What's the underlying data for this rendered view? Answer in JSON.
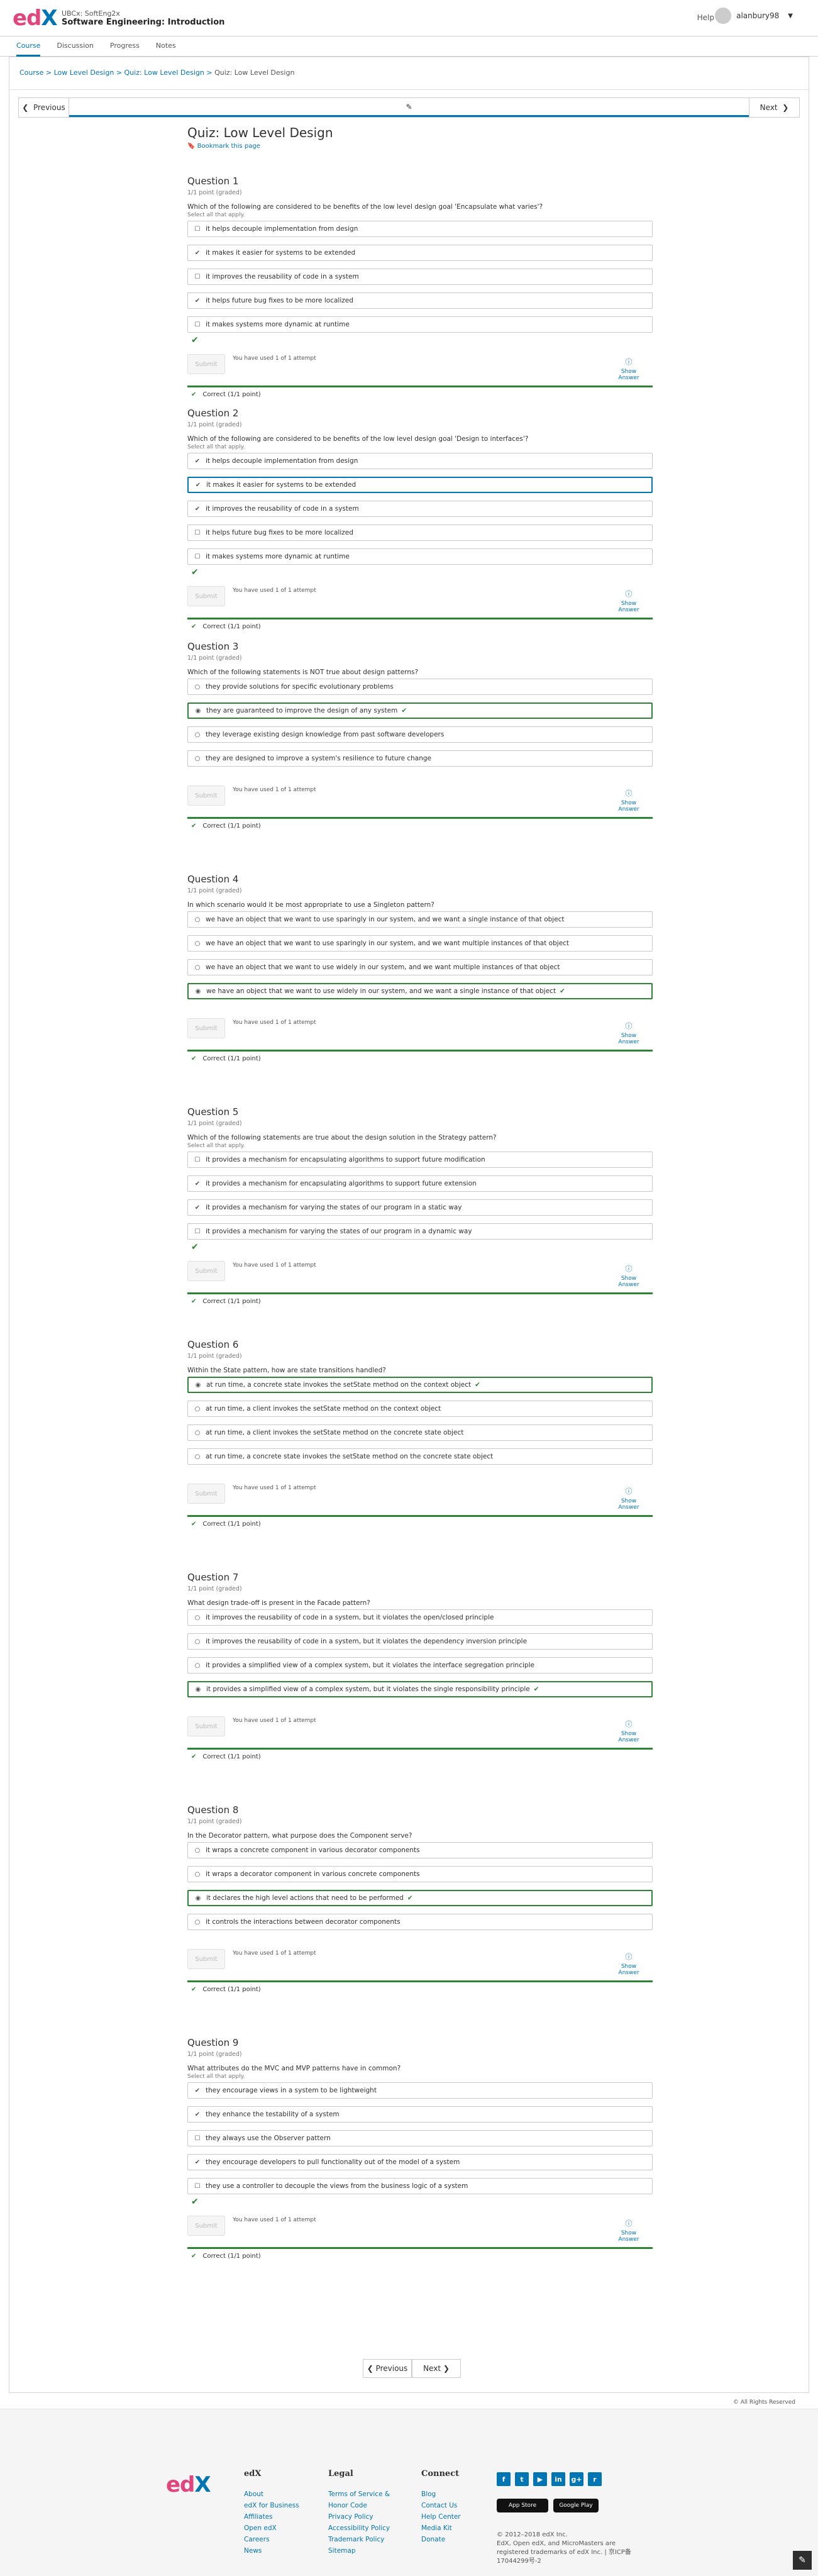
{
  "header": {
    "org": "UBCx: SoftEng2x",
    "course": "Software Engineering: Introduction",
    "help": "Help",
    "username": "alanbury98"
  },
  "tabs": [
    "Course",
    "Discussion",
    "Progress",
    "Notes"
  ],
  "breadcrumbs": {
    "course": "Course",
    "section": "Low Level Design",
    "subsection": "Quiz: Low Level Design",
    "current": "Quiz: Low Level Design"
  },
  "seqnav": {
    "prev": "Previous",
    "next": "Next"
  },
  "unit": {
    "title": "Quiz: Low Level Design",
    "bookmark": "Bookmark this page"
  },
  "common": {
    "points": "1/1 point (graded)",
    "select_all": "Select all that apply.",
    "submit": "Submit",
    "attempts": "You have used 1 of 1 attempt",
    "show_answer": "Show Answer",
    "correct": "Correct (1/1 point)"
  },
  "questions": [
    {
      "title": "Question 1",
      "text": "Which of the following are considered to be benefits of the low level design goal 'Encapsulate what varies'?",
      "multi": true,
      "options": [
        {
          "t": "it helps decouple implementation from design",
          "m": "unchecked"
        },
        {
          "t": "it makes it easier for systems to be extended",
          "m": "checked"
        },
        {
          "t": "it improves the reusability of code in a system",
          "m": "unchecked"
        },
        {
          "t": "it helps future bug fixes to be more localized",
          "m": "checked"
        },
        {
          "t": "it makes systems more dynamic at runtime",
          "m": "unchecked"
        }
      ]
    },
    {
      "title": "Question 2",
      "text": "Which of the following are considered to be benefits of the low level design goal 'Design to interfaces'?",
      "multi": true,
      "options": [
        {
          "t": "it helps decouple implementation from design",
          "m": "checked"
        },
        {
          "t": "it makes it easier for systems to be extended",
          "m": "checked",
          "sel": true
        },
        {
          "t": "it improves the reusability of code in a system",
          "m": "checked"
        },
        {
          "t": "it helps future bug fixes to be more localized",
          "m": "unchecked"
        },
        {
          "t": "it makes systems more dynamic at runtime",
          "m": "unchecked"
        }
      ]
    },
    {
      "title": "Question 3",
      "text": "Which of the following statements is NOT true about design patterns?",
      "multi": false,
      "options": [
        {
          "t": "they provide solutions for specific evolutionary problems",
          "m": "unchecked"
        },
        {
          "t": "they are guaranteed to improve the design of any system",
          "m": "checked",
          "hl": true
        },
        {
          "t": "they leverage existing design knowledge from past software developers",
          "m": "unchecked"
        },
        {
          "t": "they are designed to improve a system's resilience to future change",
          "m": "unchecked"
        }
      ]
    },
    {
      "title": "Question 4",
      "text": "In which scenario would it be most appropriate to use a Singleton pattern?",
      "multi": false,
      "options": [
        {
          "t": "we have an object that we want to use sparingly in our system, and we want a single instance of that object",
          "m": "unchecked"
        },
        {
          "t": "we have an object that we want to use sparingly in our system, and we want multiple instances of that object",
          "m": "unchecked"
        },
        {
          "t": "we have an object that we want to use widely in our system, and we want multiple instances of that object",
          "m": "unchecked"
        },
        {
          "t": "we have an object that we want to use widely in our system, and we want a single instance of that object",
          "m": "checked",
          "hl": true
        }
      ]
    },
    {
      "title": "Question 5",
      "text": "Which of the following statements are true about the design solution in the Strategy pattern?",
      "multi": true,
      "options": [
        {
          "t": "it provides a mechanism for encapsulating algorithms to support future modification",
          "m": "unchecked"
        },
        {
          "t": "it provides a mechanism for encapsulating algorithms to support future extension",
          "m": "checked"
        },
        {
          "t": "it provides a mechanism for varying the states of our program in a static way",
          "m": "checked"
        },
        {
          "t": "it provides a mechanism for varying the states of our program in a dynamic way",
          "m": "unchecked"
        }
      ]
    },
    {
      "title": "Question 6",
      "text": "Within the State pattern, how are state transitions handled?",
      "multi": false,
      "options": [
        {
          "t": "at run time, a concrete state invokes the setState method on the context object",
          "m": "checked",
          "hl": true
        },
        {
          "t": "at run time, a client invokes the setState method on the context object",
          "m": "unchecked"
        },
        {
          "t": "at run time, a client invokes the setState method on the concrete state object",
          "m": "unchecked"
        },
        {
          "t": "at run time, a concrete state invokes the setState method on the concrete state object",
          "m": "unchecked"
        }
      ]
    },
    {
      "title": "Question 7",
      "text": "What design trade-off is present in the Facade pattern?",
      "multi": false,
      "options": [
        {
          "t": "it improves the reusability of code in a system, but it violates the open/closed principle",
          "m": "unchecked"
        },
        {
          "t": "it improves the reusability of code in a system, but it violates the dependency inversion principle",
          "m": "unchecked"
        },
        {
          "t": "it provides a simplified view of a complex system, but it violates the interface segregation principle",
          "m": "unchecked"
        },
        {
          "t": "it provides a simplified view of a complex system, but it violates the single responsibility principle",
          "m": "checked",
          "hl": true
        }
      ]
    },
    {
      "title": "Question 8",
      "text": "In the Decorator pattern, what purpose does the Component serve?",
      "multi": false,
      "options": [
        {
          "t": "it wraps a concrete component in various decorator components",
          "m": "unchecked"
        },
        {
          "t": "it wraps a decorator component in various concrete components",
          "m": "unchecked"
        },
        {
          "t": "it declares the high level actions that need to be performed",
          "m": "checked",
          "hl": true
        },
        {
          "t": "it controls the interactions between decorator components",
          "m": "unchecked"
        }
      ]
    },
    {
      "title": "Question 9",
      "text": "What attributes do the MVC and MVP patterns have in common?",
      "multi": true,
      "options": [
        {
          "t": "they encourage views in a system to be lightweight",
          "m": "checked"
        },
        {
          "t": "they enhance the testability of a system",
          "m": "checked"
        },
        {
          "t": "they always use the Observer pattern",
          "m": "unchecked"
        },
        {
          "t": "they encourage developers to pull functionality out of the model of a system",
          "m": "checked"
        },
        {
          "t": "they use a controller to decouple the views from the business logic of a system",
          "m": "unchecked"
        }
      ]
    }
  ],
  "bottomnav": {
    "prev": "Previous",
    "next": "Next"
  },
  "rights": "© All Rights Reserved",
  "footer": {
    "logo": "edX",
    "cols": [
      {
        "head": "edX",
        "links": [
          "About",
          "edX for Business",
          "Affiliates",
          "Open edX",
          "Careers",
          "News"
        ]
      },
      {
        "head": "Legal",
        "links": [
          "Terms of Service & Honor Code",
          "Privacy Policy",
          "Accessibility Policy",
          "Trademark Policy",
          "Sitemap"
        ]
      },
      {
        "head": "Connect",
        "links": [
          "Blog",
          "Contact Us",
          "Help Center",
          "Media Kit",
          "Donate"
        ]
      }
    ],
    "social": [
      "f",
      "t",
      "▶",
      "in",
      "g+",
      "r"
    ],
    "appstore": "App Store",
    "googleplay": "Google Play",
    "copyright": "© 2012–2018 edX Inc.",
    "legal": "EdX, Open edX, and MicroMasters are registered trademarks of edX Inc. | 京ICP备17044299号-2"
  }
}
